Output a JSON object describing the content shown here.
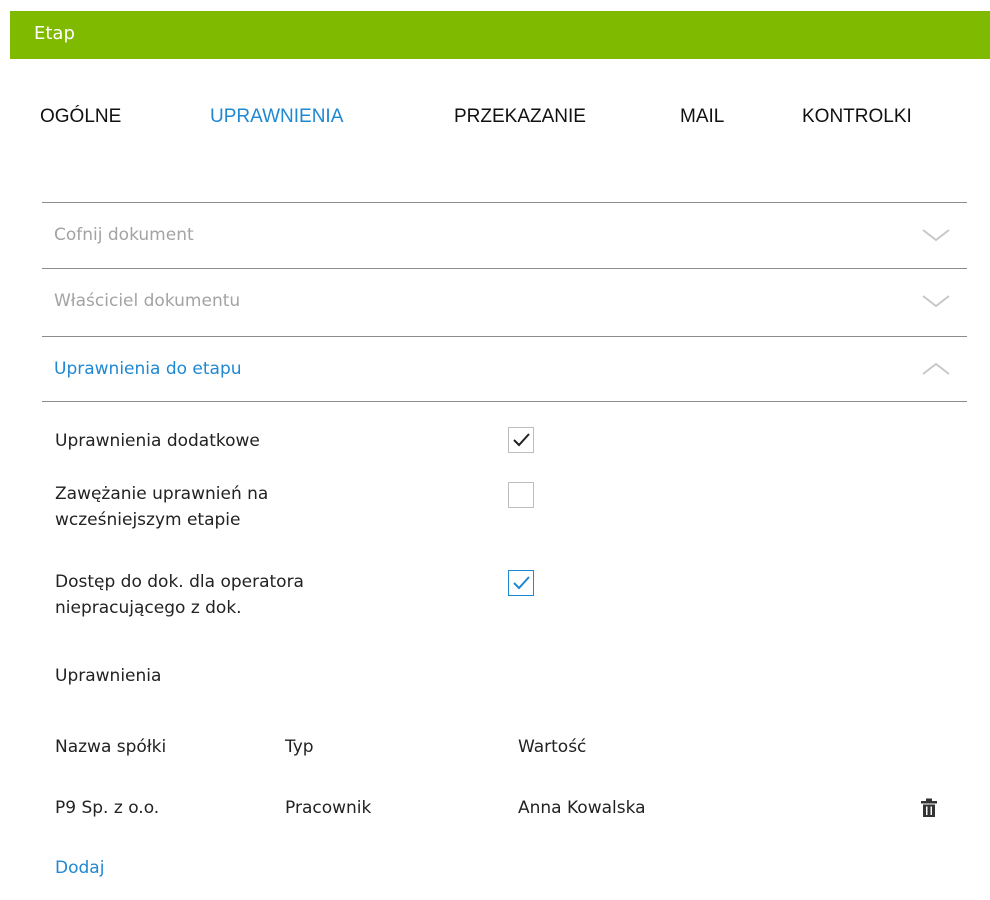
{
  "header": {
    "title": "Etap",
    "color": "#7fba00"
  },
  "tabs": [
    {
      "label": "OGÓLNE",
      "active": false
    },
    {
      "label": "UPRAWNIENIA",
      "active": true
    },
    {
      "label": "PRZEKAZANIE",
      "active": false
    },
    {
      "label": "MAIL",
      "active": false
    },
    {
      "label": "KONTROLKI",
      "active": false
    }
  ],
  "accordions": [
    {
      "label": "Cofnij dokument",
      "expanded": false,
      "icon": "chevron-down-icon"
    },
    {
      "label": "Właściciel dokumentu",
      "expanded": false,
      "icon": "chevron-down-icon"
    },
    {
      "label": "Uprawnienia do etapu",
      "expanded": true,
      "icon": "chevron-up-icon"
    }
  ],
  "settings": [
    {
      "label_lines": [
        "Uprawnienia dodatkowe"
      ],
      "checked": true
    },
    {
      "label_lines": [
        "Zawężanie uprawnień na",
        "wcześniejszym etapie"
      ],
      "checked": false
    },
    {
      "label_lines": [
        "Dostęp do dok. dla operatora",
        "niepracującego z dok."
      ],
      "checked": true
    }
  ],
  "permissions": {
    "section_label": "Uprawnienia",
    "columns": [
      "Nazwa spółki",
      "Typ",
      "Wartość"
    ],
    "rows": [
      {
        "company": "P9 Sp. z o.o.",
        "type": "Pracownik",
        "value": "Anna Kowalska",
        "action_icon": "trash-icon"
      }
    ],
    "add_label": "Dodaj"
  },
  "colors": {
    "accent": "#1e88d2",
    "muted_text": "#a3a3a3",
    "divider": "#8c8c8c"
  }
}
